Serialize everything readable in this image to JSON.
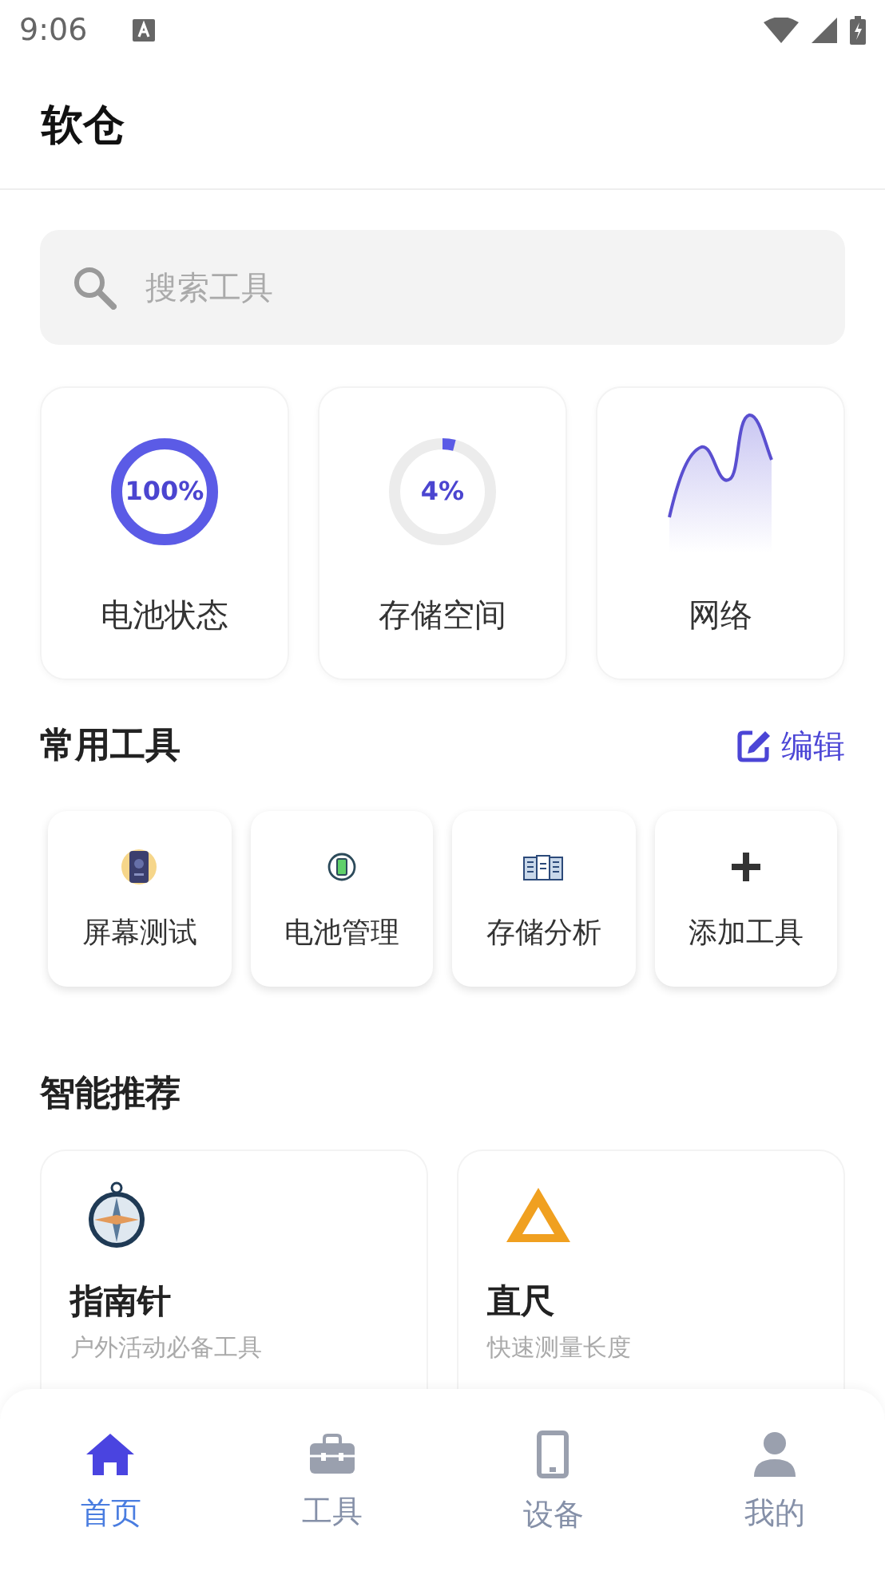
{
  "status_bar": {
    "time": "9:06"
  },
  "header": {
    "title": "软仓"
  },
  "search": {
    "placeholder": "搜索工具"
  },
  "stat_cards": [
    {
      "kind": "ring",
      "value": "100%",
      "label": "电池状态",
      "level": 1
    },
    {
      "kind": "ring",
      "value": "4%",
      "label": "存储空间",
      "level": 0.04
    },
    {
      "kind": "wave",
      "label": "网络"
    }
  ],
  "common_tools": {
    "title": "常用工具",
    "edit": "编辑",
    "items": [
      {
        "kind": "phone",
        "label": "屏幕测试"
      },
      {
        "kind": "battery",
        "label": "电池管理"
      },
      {
        "kind": "storage",
        "label": "存储分析"
      },
      {
        "kind": "add",
        "label": "添加工具"
      }
    ]
  },
  "recommendations": {
    "title": "智能推荐",
    "items": [
      {
        "kind": "compass",
        "title": "指南针",
        "subtitle": "户外活动必备工具"
      },
      {
        "kind": "ruler",
        "title": "直尺",
        "subtitle": "快速测量长度"
      }
    ]
  },
  "bottom_nav": [
    {
      "kind": "home",
      "label": "首页",
      "selected": true
    },
    {
      "kind": "toolbox",
      "label": "工具",
      "selected": false
    },
    {
      "kind": "device",
      "label": "设备",
      "selected": false
    },
    {
      "kind": "person",
      "label": "我的",
      "selected": false
    }
  ]
}
